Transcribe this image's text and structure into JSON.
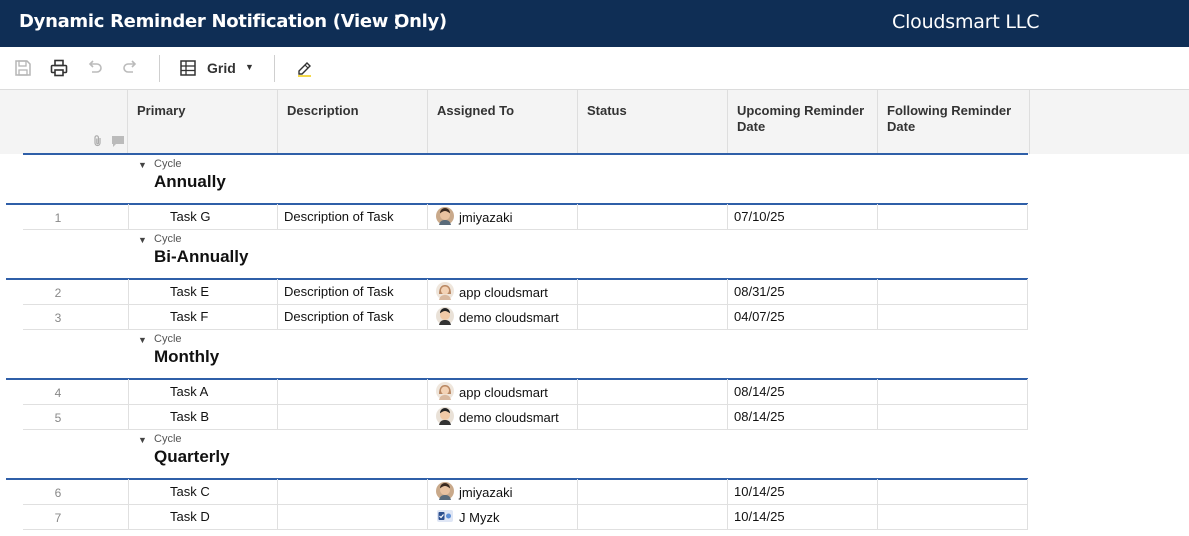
{
  "header": {
    "title": "Dynamic Reminder Notification (View Only)",
    "menu_glyph": "⋮",
    "brand": "Cloudsmart LLC"
  },
  "toolbar": {
    "icons": [
      "save-icon",
      "print-icon",
      "undo-icon",
      "redo-icon",
      "grid-icon",
      "highlight-icon"
    ],
    "view_label": "Grid"
  },
  "columns": [
    {
      "label": "Primary"
    },
    {
      "label": "Description"
    },
    {
      "label": "Assigned To"
    },
    {
      "label": "Status"
    },
    {
      "label": "Upcoming Reminder Date"
    },
    {
      "label": "Following Reminder Date"
    }
  ],
  "groups": [
    {
      "label": "Cycle",
      "name": "Annually",
      "rows": [
        {
          "num": "1",
          "primary": "Task G",
          "description": "Description of Task",
          "assigned": "jmiyazaki",
          "avatar": "man",
          "status": "",
          "upcoming": "07/10/25",
          "following": ""
        }
      ]
    },
    {
      "label": "Cycle",
      "name": "Bi-Annually",
      "rows": [
        {
          "num": "2",
          "primary": "Task E",
          "description": "Description of Task",
          "assigned": "app cloudsmart",
          "avatar": "woman",
          "status": "",
          "upcoming": "08/31/25",
          "following": ""
        },
        {
          "num": "3",
          "primary": "Task F",
          "description": "Description of Task",
          "assigned": "demo cloudsmart",
          "avatar": "man2",
          "status": "",
          "upcoming": "04/07/25",
          "following": ""
        }
      ]
    },
    {
      "label": "Cycle",
      "name": "Monthly",
      "rows": [
        {
          "num": "4",
          "primary": "Task A",
          "description": "",
          "assigned": "app cloudsmart",
          "avatar": "woman",
          "status": "",
          "upcoming": "08/14/25",
          "following": ""
        },
        {
          "num": "5",
          "primary": "Task B",
          "description": "",
          "assigned": "demo cloudsmart",
          "avatar": "man2",
          "status": "",
          "upcoming": "08/14/25",
          "following": ""
        }
      ]
    },
    {
      "label": "Cycle",
      "name": "Quarterly",
      "rows": [
        {
          "num": "6",
          "primary": "Task C",
          "description": "",
          "assigned": "jmiyazaki",
          "avatar": "man",
          "status": "",
          "upcoming": "10/14/25",
          "following": ""
        },
        {
          "num": "7",
          "primary": "Task D",
          "description": "",
          "assigned": "J Myzk",
          "avatar": "badge",
          "status": "",
          "upcoming": "10/14/25",
          "following": ""
        }
      ]
    }
  ],
  "colors": {
    "titlebar": "#0f2e55",
    "accent_line": "#2f5fa8"
  }
}
